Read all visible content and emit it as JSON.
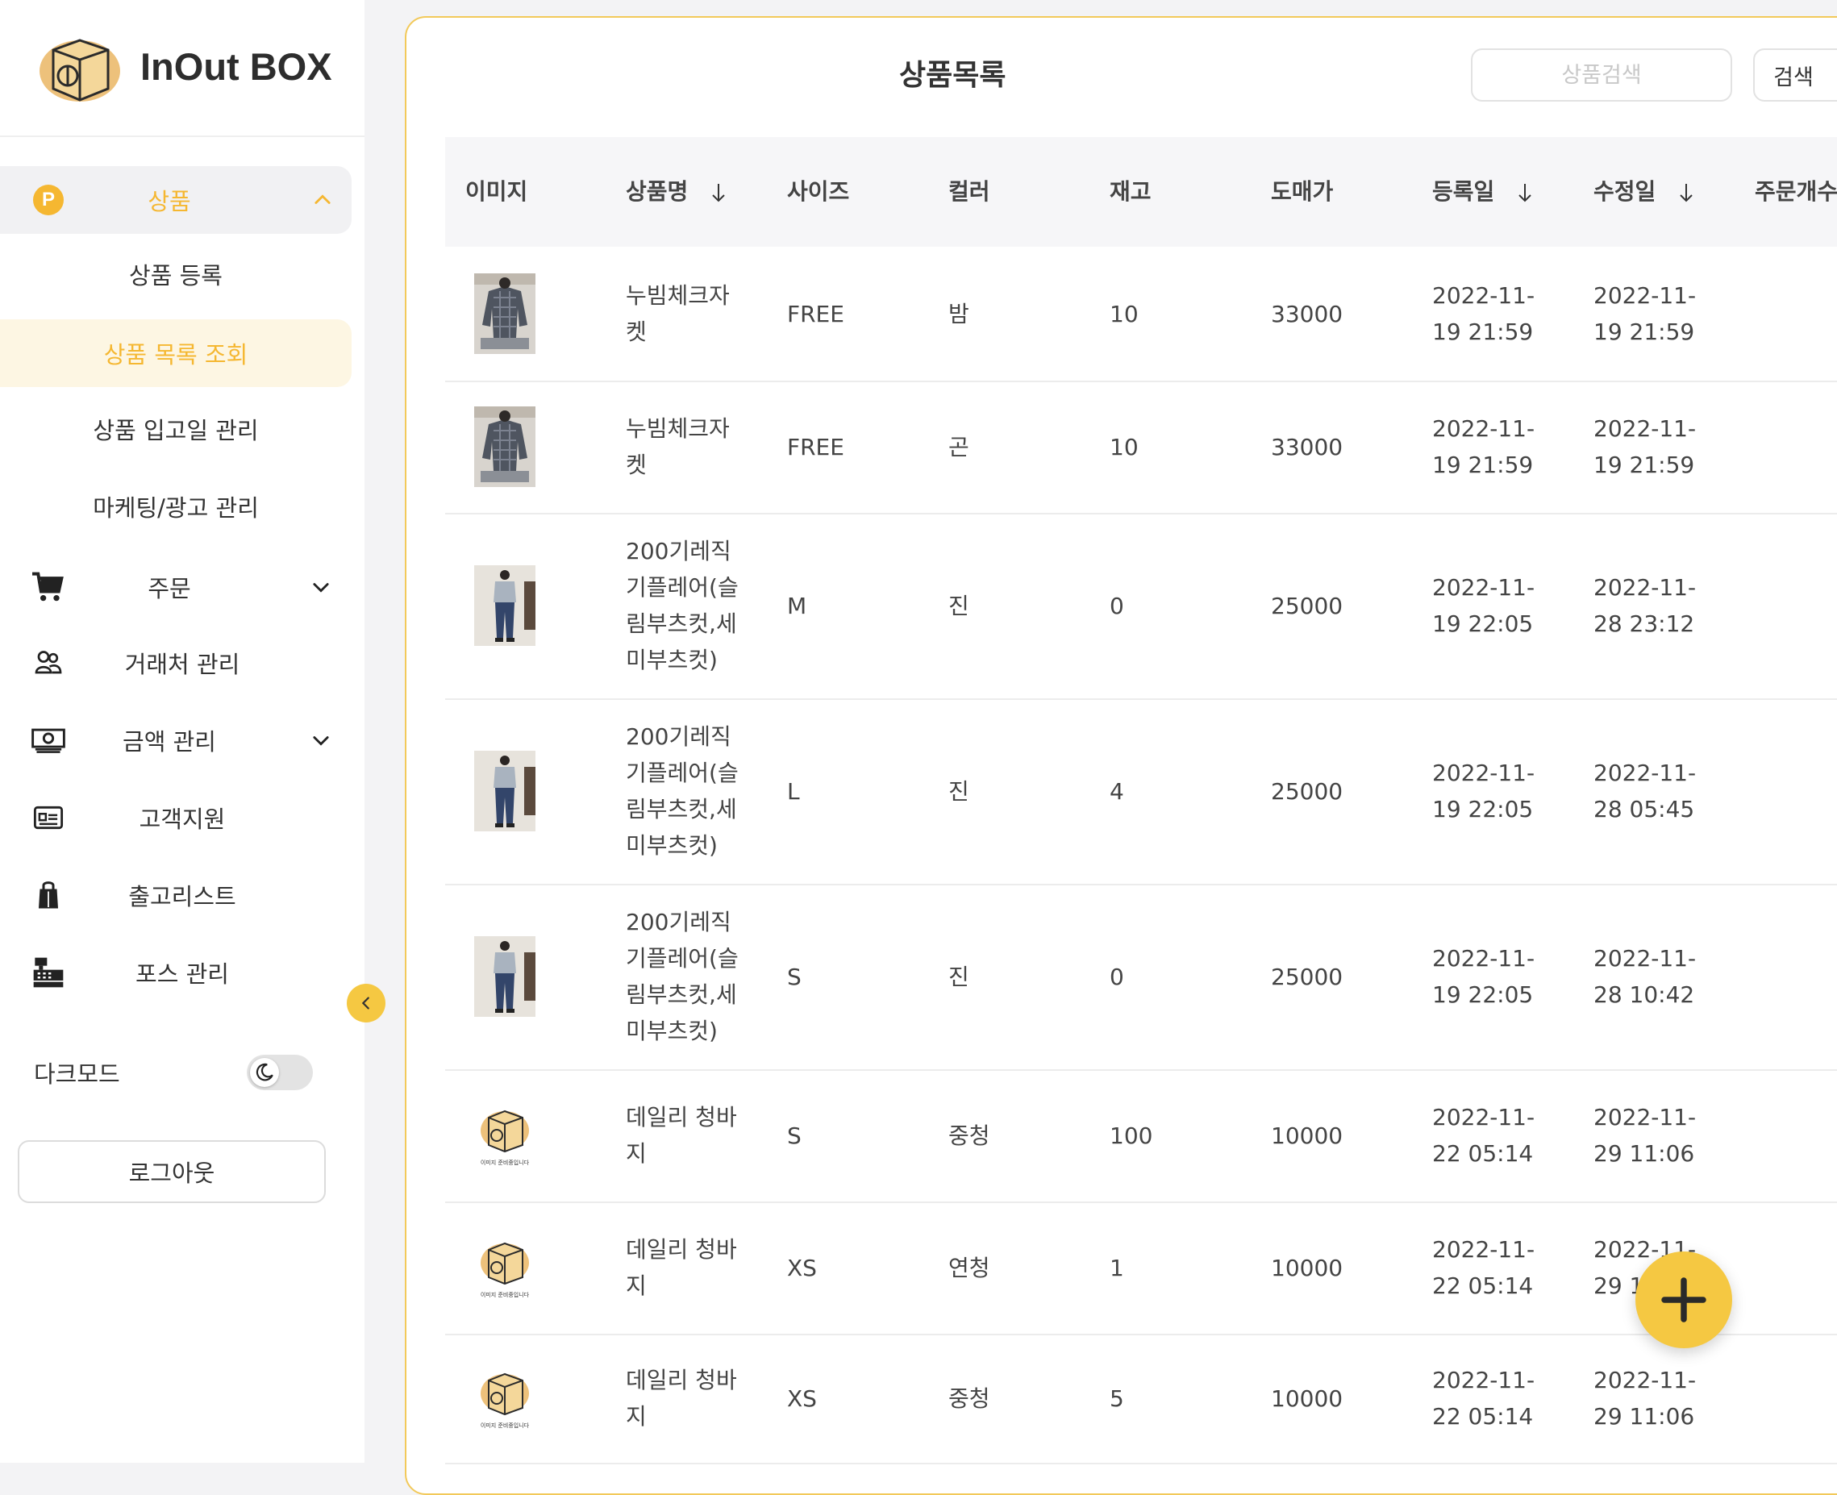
{
  "brand": {
    "name": "InOut BOX"
  },
  "sidebar": {
    "product": "상품",
    "sub_items": [
      "상품 등록",
      "상품 목록 조회",
      "상품 입고일 관리",
      "마케팅/광고 관리"
    ],
    "order": "주문",
    "partner": "거래처 관리",
    "amount": "금액 관리",
    "support": "고객지원",
    "shipping": "출고리스트",
    "pos": "포스 관리",
    "dark_mode": "다크모드",
    "logout": "로그아웃",
    "p_badge": "P"
  },
  "header": {
    "title": "상품목록",
    "search_placeholder": "상품검색",
    "search_button": "검색"
  },
  "columns": [
    "이미지",
    "상품명",
    "사이즈",
    "컬러",
    "재고",
    "도매가",
    "등록일",
    "수정일",
    "주문개수"
  ],
  "rows": [
    {
      "name_lines": [
        "누빔체크자",
        "켓"
      ],
      "size": "FREE",
      "color": "밤",
      "stock": "10",
      "price": "33000",
      "reg": [
        "2022-11-",
        "19 21:59"
      ],
      "mod": [
        "2022-11-",
        "19 21:59"
      ],
      "img": "photo-jacket"
    },
    {
      "name_lines": [
        "누빔체크자",
        "켓"
      ],
      "size": "FREE",
      "color": "곤",
      "stock": "10",
      "price": "33000",
      "reg": [
        "2022-11-",
        "19 21:59"
      ],
      "mod": [
        "2022-11-",
        "19 21:59"
      ],
      "img": "photo-jacket"
    },
    {
      "name_lines": [
        "200기레직",
        "기플레어(슬",
        "림부츠컷,세",
        "미부츠컷)"
      ],
      "size": "M",
      "color": "진",
      "stock": "0",
      "price": "25000",
      "reg": [
        "2022-11-",
        "19 22:05"
      ],
      "mod": [
        "2022-11-",
        "28 23:12"
      ],
      "img": "photo-jeans"
    },
    {
      "name_lines": [
        "200기레직",
        "기플레어(슬",
        "림부츠컷,세",
        "미부츠컷)"
      ],
      "size": "L",
      "color": "진",
      "stock": "4",
      "price": "25000",
      "reg": [
        "2022-11-",
        "19 22:05"
      ],
      "mod": [
        "2022-11-",
        "28 05:45"
      ],
      "img": "photo-jeans"
    },
    {
      "name_lines": [
        "200기레직",
        "기플레어(슬",
        "림부츠컷,세",
        "미부츠컷)"
      ],
      "size": "S",
      "color": "진",
      "stock": "0",
      "price": "25000",
      "reg": [
        "2022-11-",
        "19 22:05"
      ],
      "mod": [
        "2022-11-",
        "28 10:42"
      ],
      "img": "photo-jeans"
    },
    {
      "name_lines": [
        "데일리 청바",
        "지"
      ],
      "size": "S",
      "color": "중청",
      "stock": "100",
      "price": "10000",
      "reg": [
        "2022-11-",
        "22 05:14"
      ],
      "mod": [
        "2022-11-",
        "29 11:06"
      ],
      "img": "placeholder-box"
    },
    {
      "name_lines": [
        "데일리 청바",
        "지"
      ],
      "size": "XS",
      "color": "연청",
      "stock": "1",
      "price": "10000",
      "reg": [
        "2022-11-",
        "22 05:14"
      ],
      "mod": [
        "2022-11-",
        "29 1"
      ],
      "img": "placeholder-box"
    },
    {
      "name_lines": [
        "데일리 청바",
        "지"
      ],
      "size": "XS",
      "color": "중청",
      "stock": "5",
      "price": "10000",
      "reg": [
        "2022-11-",
        "22 05:14"
      ],
      "mod": [
        "2022-11-",
        "29 11:06"
      ],
      "img": "placeholder-box"
    }
  ],
  "placeholder_caption": "이미지 준비중입니다",
  "colors": {
    "accent": "#f5b731",
    "accent_soft": "#fdf6e3",
    "fab": "#f5c842"
  }
}
